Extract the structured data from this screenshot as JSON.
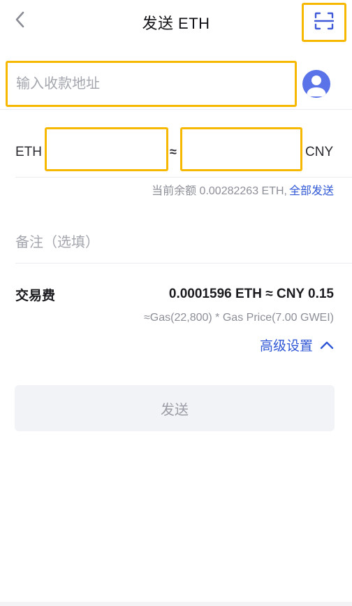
{
  "header": {
    "title": "发送 ETH",
    "back_icon": "chevron-left-icon",
    "scan_icon": "scan-qr-icon"
  },
  "address": {
    "placeholder": "输入收款地址",
    "value": "",
    "contact_icon": "contact-avatar-icon"
  },
  "amount": {
    "left_unit": "ETH",
    "eth_value": "",
    "approx": "≈",
    "cny_value": "",
    "right_unit": "CNY"
  },
  "balance": {
    "text": "当前余额 0.00282263 ETH,",
    "send_all": "全部发送"
  },
  "memo": {
    "placeholder": "备注（选填）"
  },
  "fee": {
    "label": "交易费",
    "value": "0.0001596 ETH ≈ CNY 0.15",
    "formula": "≈Gas(22,800) * Gas Price(7.00 GWEI)",
    "advanced": "高级设置",
    "advanced_icon": "chevron-up-icon"
  },
  "actions": {
    "send": "发送"
  },
  "colors": {
    "highlight_border": "#f6b800",
    "link_blue": "#2f57d6",
    "avatar_blue": "#5b73e8",
    "button_bg": "#f2f3f6"
  }
}
